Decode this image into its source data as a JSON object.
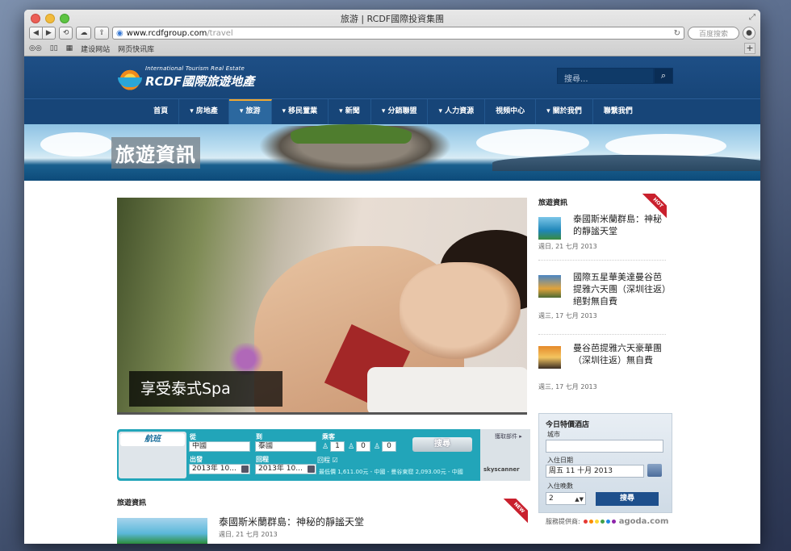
{
  "browser": {
    "title": "旅游 | RCDF國際投資集團",
    "url_domain": "www.rcdfgroup.com",
    "url_path": "/travel",
    "search_placeholder": "百度搜索",
    "bookmarks": [
      "建设网站",
      "网页快讯库"
    ]
  },
  "header": {
    "logo_sub": "International Tourism Real Estate",
    "logo_main": "RCDF國際旅遊地產",
    "search_placeholder": "搜尋..."
  },
  "nav": {
    "items": [
      {
        "label": "首頁"
      },
      {
        "label": "▾ 房地產"
      },
      {
        "label": "▾ 旅游"
      },
      {
        "label": "▾ 移民置業"
      },
      {
        "label": "▾ 新聞"
      },
      {
        "label": "▾ 分銷聯盟"
      },
      {
        "label": "▾ 人力資源"
      },
      {
        "label": "視頻中心"
      },
      {
        "label": "▾ 關於我們"
      },
      {
        "label": "聯繫我們"
      }
    ],
    "active_index": 2
  },
  "banner": {
    "title": "旅遊資訊"
  },
  "slider": {
    "caption": "享受泰式Spa"
  },
  "flight": {
    "tab": "航班",
    "from_label": "從",
    "from_value": "中國",
    "to_label": "到",
    "to_value": "泰國",
    "passengers_label": "乘客",
    "adults": "1",
    "children": "0",
    "infants": "0",
    "search": "搜尋",
    "depart_label": "出發",
    "depart_value": "2013年 10...",
    "return_label": "回程",
    "return_value": "2013年 10...",
    "roundtrip_label": "回程 ☑",
    "price_text": "最低價 1,611.00元 - 中國 - 曼谷東窟 2,093.00元 - 中國",
    "side_label": "獲取部件 ▸",
    "side_logo": "skyscanner"
  },
  "news": {
    "header": "旅遊資訊",
    "badge": "NEW",
    "items": [
      {
        "title": "泰國斯米蘭群島：神秘的靜謐天堂",
        "date": "週日, 21 七月 2013"
      }
    ]
  },
  "sidebar": {
    "header": "旅遊資訊",
    "badge": "HOT",
    "items": [
      {
        "title": "泰國斯米蘭群島：神秘的靜謐天堂",
        "date": "週日, 21 七月 2013"
      },
      {
        "title": "國際五星華美達曼谷芭提雅六天團（深圳往返）絕對無自費",
        "date": "週三, 17 七月 2013"
      },
      {
        "title": "曼谷芭提雅六天豪華團（深圳往返）無自費",
        "date": "週三, 17 七月 2013"
      }
    ]
  },
  "hotel": {
    "title": "今日特價酒店",
    "city_label": "城市",
    "city_value": "",
    "checkin_label": "入住日期",
    "checkin_value": "周五 11 十月 2013",
    "nights_label": "入住晚數",
    "nights_value": "2",
    "search": "搜尋",
    "provider_label": "服務提供商:",
    "provider_name": "agoda.com"
  },
  "colors": {
    "header_blue": "#174578",
    "nav_active": "#2c689f",
    "flight_teal": "#22a5b9",
    "hot_red": "#c9202d"
  }
}
